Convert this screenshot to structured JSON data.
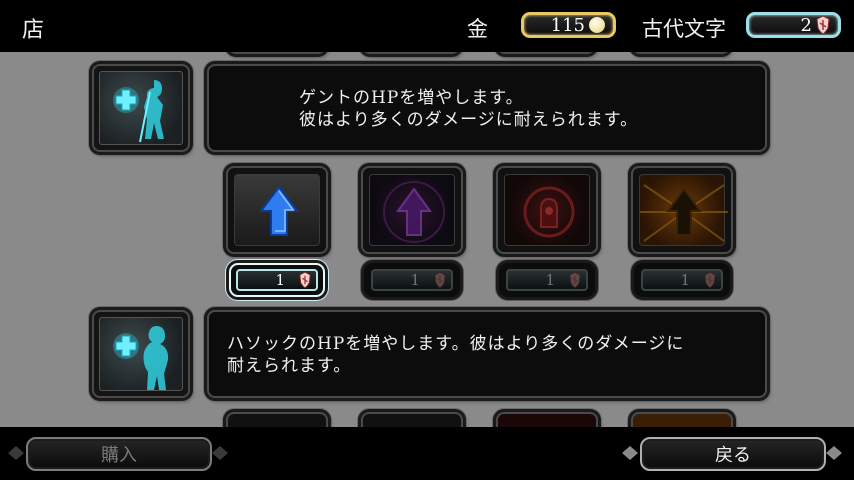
{
  "header": {
    "title": "店",
    "gold_label": "金",
    "gold_value": "115",
    "runes_label": "古代文字",
    "runes_value": "2"
  },
  "items": [
    {
      "description_line1": "ゲントのHPを増やします。",
      "description_line2": "彼はより多くのダメージに耐えられます。",
      "upgrades": [
        {
          "icon": "blue-arrow-icon",
          "cost": "1",
          "state": "available"
        },
        {
          "icon": "purple-arrow-icon",
          "cost": "1",
          "state": "locked"
        },
        {
          "icon": "red-rune-icon",
          "cost": "1",
          "state": "locked"
        },
        {
          "icon": "gold-arrow-icon",
          "cost": "1",
          "state": "locked"
        }
      ]
    },
    {
      "description_line1": "ハソックのHPを増やします。彼はより多くのダメージに",
      "description_line2": "耐えられます。"
    }
  ],
  "footer": {
    "buy_label": "購入",
    "back_label": "戻る"
  },
  "colors": {
    "gold_border": "#e8c862",
    "cyan_border": "#9ee0ea",
    "upgrade_blue": "#2e7cf0"
  }
}
